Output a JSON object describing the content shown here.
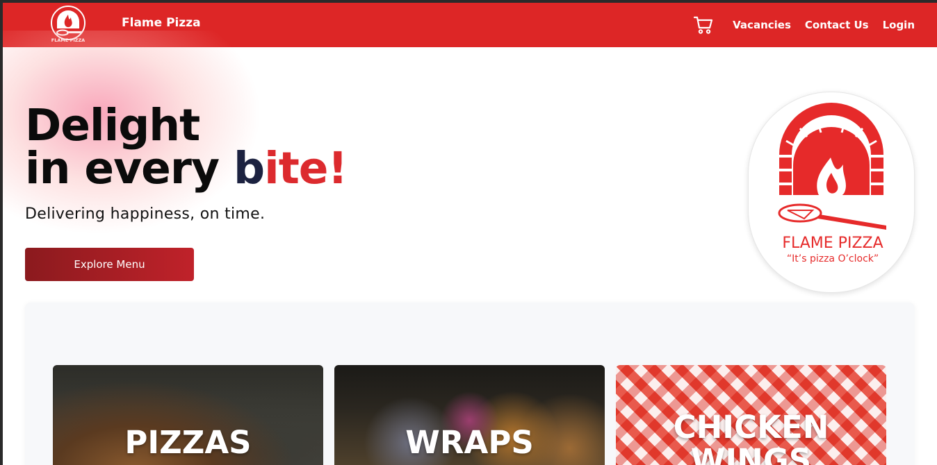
{
  "navbar": {
    "brand": "Flame Pizza",
    "links": [
      "Vacancies",
      "Contact Us",
      "Login"
    ],
    "cart_icon": "cart-icon",
    "background": "#dd2626"
  },
  "hero": {
    "title_line1": "Delight",
    "title_line2_prefix": "in every ",
    "title_accent_b": "b",
    "title_accent_rest": "ite!",
    "subtitle": "Delivering happiness, on time.",
    "cta_label": "Explore Menu"
  },
  "logo": {
    "name": "FLAME PIZZA",
    "tagline": "“It’s pizza O’clock”",
    "color": "#e62a2a"
  },
  "menu": {
    "cards": [
      {
        "label": "PIZZAS"
      },
      {
        "label": "WRAPS"
      },
      {
        "label": "CHICKEN WINGS"
      }
    ]
  }
}
